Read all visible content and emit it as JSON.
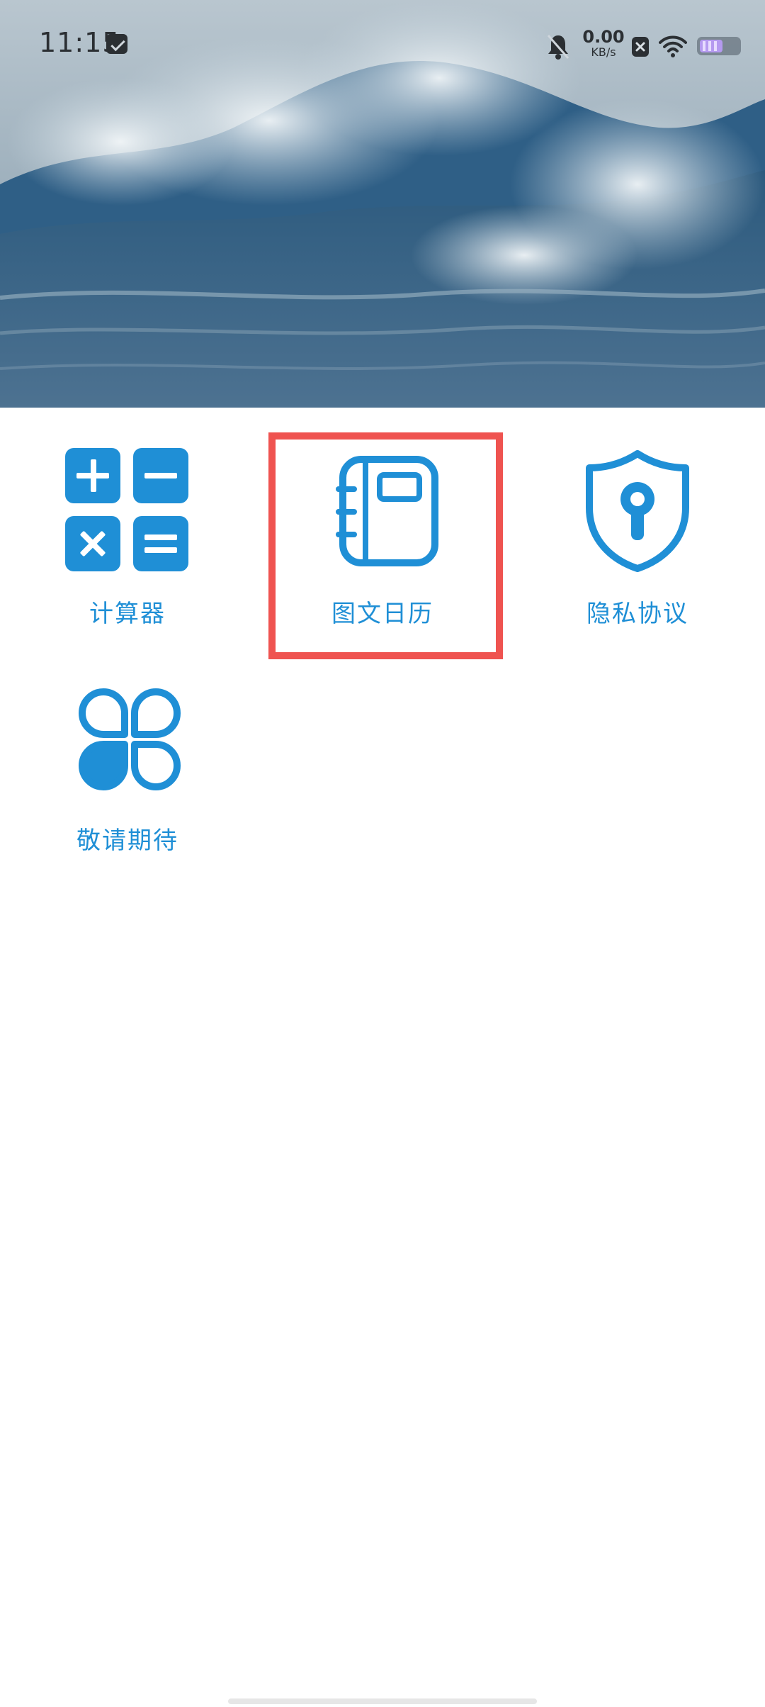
{
  "status_bar": {
    "time": "11:15",
    "net_speed_value": "0.00",
    "net_speed_unit": "KB/s",
    "icons": [
      "message-icon",
      "bell-muted-icon",
      "sim-x-icon",
      "wifi-icon",
      "battery-icon"
    ]
  },
  "apps": [
    {
      "label": "计算器",
      "icon": "calculator-icon"
    },
    {
      "label": "图文日历",
      "icon": "notebook-icon"
    },
    {
      "label": "隐私协议",
      "icon": "shield-keyhole-icon"
    },
    {
      "label": "敬请期待",
      "icon": "clover-icon"
    }
  ],
  "colors": {
    "accent": "#1f8fd6",
    "highlight": "#ef5350"
  }
}
